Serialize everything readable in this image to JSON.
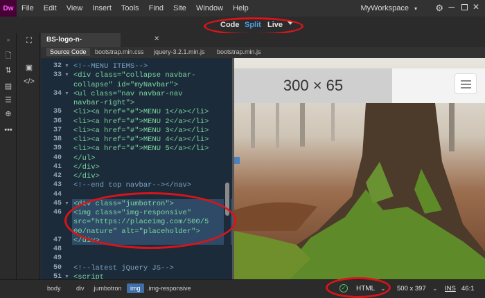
{
  "app": {
    "logo": "Dw"
  },
  "menu": [
    "File",
    "Edit",
    "View",
    "Insert",
    "Tools",
    "Find",
    "Site",
    "Window",
    "Help"
  ],
  "workspace": "MyWorkspace",
  "views": {
    "code": "Code",
    "split": "Split",
    "live": "Live",
    "active": "Split"
  },
  "document": {
    "tab": "BS-logo-n-navbar.html*"
  },
  "related_files": [
    "Source Code",
    "bootstrap.min.css",
    "jquery-3.2.1.min.js",
    "bootstrap.min.js"
  ],
  "code_lines": [
    {
      "num": "32",
      "fold": true,
      "text": "<!--MENU ITEMS-->"
    },
    {
      "num": "33",
      "fold": true,
      "text": "<div class=\"collapse navbar-"
    },
    {
      "num": "",
      "fold": false,
      "text": "collapse\" id=\"myNavbar\">"
    },
    {
      "num": "34",
      "fold": true,
      "text": "<ul class=\"nav navbar-nav"
    },
    {
      "num": "",
      "fold": false,
      "text": "navbar-right\">"
    },
    {
      "num": "35",
      "fold": false,
      "text": "<li><a href=\"#\">MENU 1</a></li>"
    },
    {
      "num": "36",
      "fold": false,
      "text": "<li><a href=\"#\">MENU 2</a></li>"
    },
    {
      "num": "37",
      "fold": false,
      "text": "<li><a href=\"#\">MENU 3</a></li>"
    },
    {
      "num": "38",
      "fold": false,
      "text": "<li><a href=\"#\">MENU 4</a></li>"
    },
    {
      "num": "39",
      "fold": false,
      "text": "<li><a href=\"#\">MENU 5</a></li>"
    },
    {
      "num": "40",
      "fold": false,
      "text": "</ul>"
    },
    {
      "num": "41",
      "fold": false,
      "text": "</div>"
    },
    {
      "num": "42",
      "fold": false,
      "text": "</div>"
    },
    {
      "num": "43",
      "fold": false,
      "text": "<!--end top navbar--></nav>"
    },
    {
      "num": "44",
      "fold": false,
      "text": ""
    },
    {
      "num": "45",
      "fold": true,
      "text": "<div class=\"jumbotron\">"
    },
    {
      "num": "46",
      "fold": false,
      "text": "<img class=\"img-responsive\""
    },
    {
      "num": "",
      "fold": false,
      "text": "src=\"https://placeimg.com/500/5"
    },
    {
      "num": "",
      "fold": false,
      "text": "00/nature\" alt=\"placeholder\">"
    },
    {
      "num": "47",
      "fold": false,
      "text": "</div>"
    },
    {
      "num": "48",
      "fold": false,
      "text": ""
    },
    {
      "num": "49",
      "fold": false,
      "text": ""
    },
    {
      "num": "50",
      "fold": false,
      "text": "<!--latest jQuery JS-->"
    },
    {
      "num": "51",
      "fold": true,
      "text": "<script"
    }
  ],
  "live_view": {
    "placeholder_text": "300 × 65"
  },
  "breadcrumbs": [
    "body",
    "div",
    ".jumbotron",
    "img",
    ".img-responsive"
  ],
  "status": {
    "doc_type": "HTML",
    "dimensions": "500 x 397",
    "mode": "INS",
    "position": "46:1"
  },
  "colors": {
    "accent": "#4d9de0",
    "annotation": "#d9141a",
    "code_bg": "#1c2b3a"
  },
  "icons": [
    "files-icon",
    "transfer-icon",
    "insert-icon",
    "css-icon",
    "dom-icon",
    "more-icon",
    "dom-tree-icon",
    "properties-icon",
    "code-icon",
    "gear-icon"
  ]
}
